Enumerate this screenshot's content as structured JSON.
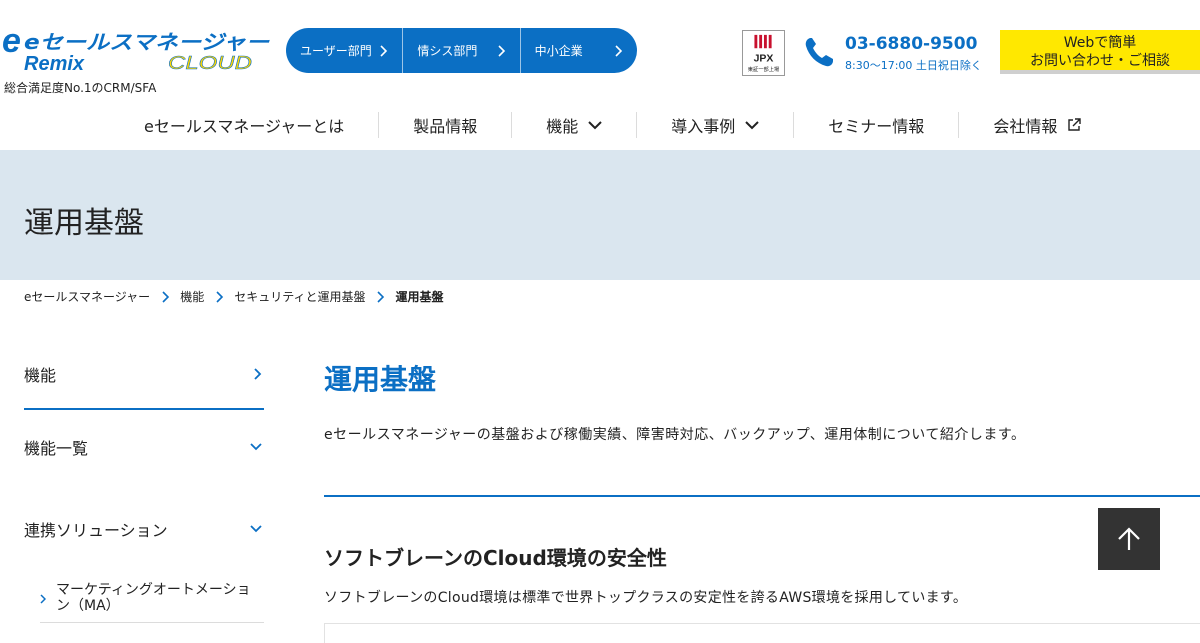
{
  "brand": {
    "logo_line1": "eセールスマネージャー",
    "logo_line2": "Remix",
    "logo_line3": "CLOUD",
    "tagline": "総合満足度No.1のCRM/SFA",
    "color": "#0b6fc4"
  },
  "segment_nav": [
    {
      "label": "ユーザー部門"
    },
    {
      "label": "情シス部門"
    },
    {
      "label": "中小企業"
    }
  ],
  "jpx": {
    "label": "JPX",
    "sub": "東証一部上場"
  },
  "phone": {
    "number": "03-6880-9500",
    "hours": "8:30～17:00 土日祝日除く"
  },
  "contact": {
    "line1": "Webで簡単",
    "line2": "お問い合わせ・ご相談"
  },
  "main_nav": [
    {
      "label": "eセールスマネージャーとは"
    },
    {
      "label": "製品情報"
    },
    {
      "label": "機能"
    },
    {
      "label": "導入事例"
    },
    {
      "label": "セミナー情報"
    },
    {
      "label": "会社情報"
    }
  ],
  "hero": {
    "title": "運用基盤"
  },
  "breadcrumb": [
    {
      "label": "eセールスマネージャー"
    },
    {
      "label": "機能"
    },
    {
      "label": "セキュリティと運用基盤"
    },
    {
      "label": "運用基盤"
    }
  ],
  "sidebar": {
    "top": "機能",
    "items": [
      {
        "label": "機能一覧"
      },
      {
        "label": "連携ソリューション"
      }
    ],
    "sub": [
      {
        "label": "マーケティングオートメーション（MA）"
      }
    ]
  },
  "content": {
    "title": "運用基盤",
    "lead": "eセールスマネージャーの基盤および稼働実績、障害時対応、バックアップ、運用体制について紹介します。",
    "section_title": "ソフトブレーンのCloud環境の安全性",
    "section_text": "ソフトブレーンのCloud環境は標準で世界トップクラスの安定性を誇るAWS環境を採用しています。"
  }
}
